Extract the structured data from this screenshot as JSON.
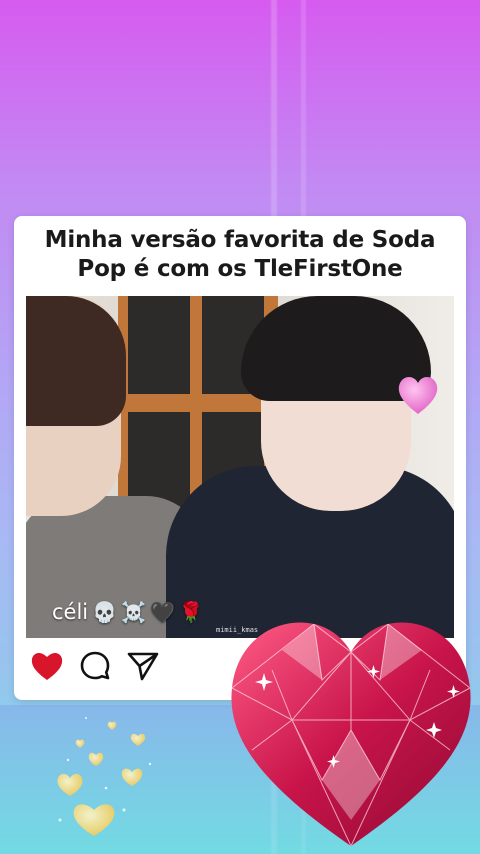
{
  "post": {
    "title": "Minha versão favorita de Soda Pop é com os TleFirstOne"
  },
  "video": {
    "caption_name": "céli",
    "caption_emojis": [
      "💀",
      "☠️",
      "🖤",
      "🌹"
    ],
    "watermark": "mimii_kmas"
  },
  "actions": {
    "like_icon": "heart-icon",
    "comment_icon": "comment-icon",
    "share_icon": "send-icon",
    "bookmark_icon": "bookmark-icon",
    "liked": true
  },
  "colors": {
    "like_red": "#d8152b",
    "diamond_heart": "#c8144a",
    "sticker_pink": "#f07cd2"
  }
}
